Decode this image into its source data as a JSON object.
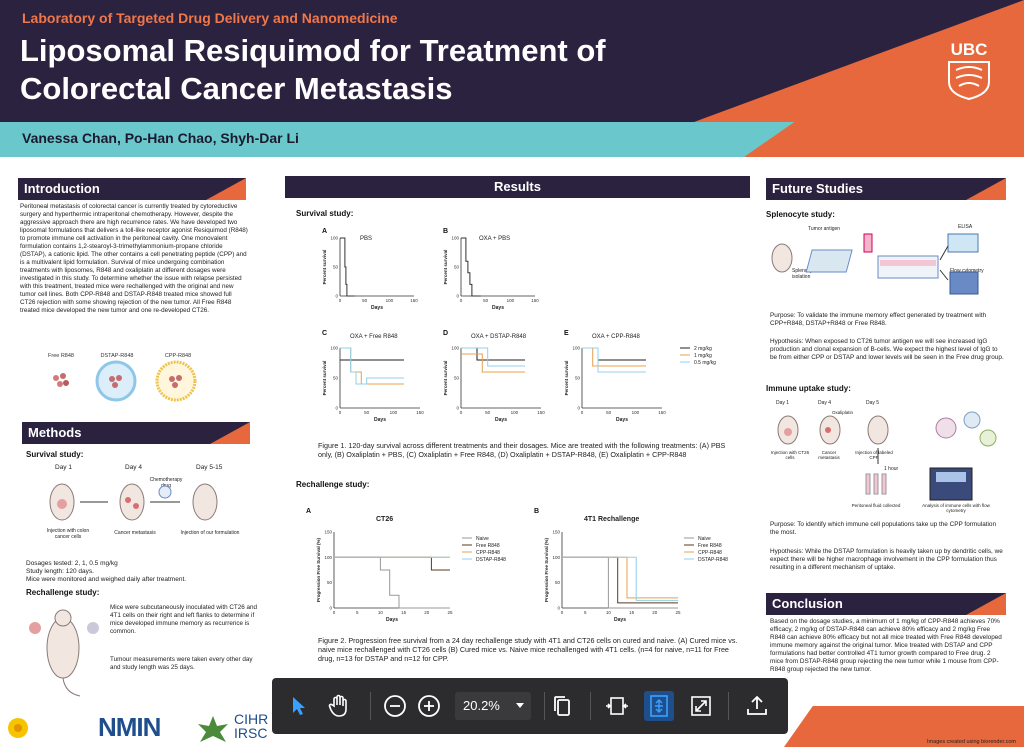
{
  "header": {
    "lab": "Laboratory of Targeted Drug Delivery and Nanomedicine",
    "title": "Liposomal Resiquimod for Treatment of Colorectal Cancer Metastasis",
    "authors": "Vanessa Chan, Po-Han Chao, Shyh-Dar Li",
    "logo": "UBC"
  },
  "intro": {
    "heading": "Introduction",
    "text": "Peritoneal metastasis of colorectal cancer is currently treated by cytoreductive surgery and hyperthermic intraperitonal chemotherapy. However, despite the aggressive approach there are high recurrence rates. We have developed two liposomal formulations that delivers a toll-like receptor agonist Resiquimod (R848) to promote immune cell activation in the peritoneal cavity. One monovalent formulation contains 1,2-stearoyl-3-trimethylammonium-propane chloride (DSTAP), a cationic lipid. The other contains a cell penetrating peptide (CPP) and is a multivalent lipid formulation. Survival of mice undergoing combination treatments with liposomes, R848 and oxaliplatin at different dosages were investigated in this study. To determine whether the issue with relapse persisted with this treatment, treated mice were rechallenged with the original and new tumor cell lines. Both CPP-R848 and DSTAP-R848 treated mice showed full CT26 rejection with some showing rejection of the new tumor. All Free R848 treated mice developed the new tumor and one re-developed CT26.",
    "icons": [
      "Free R848",
      "DSTAP-R848",
      "CPP-R848"
    ]
  },
  "methods": {
    "heading": "Methods",
    "survival_head": "Survival study:",
    "days": [
      "Day 1",
      "Day 4",
      "Day 5-15"
    ],
    "chemo": "Chemotherapy drug",
    "step_labels": [
      "Injection with colon cancer cells",
      "Cancer metastasis",
      "Injection of our formulation"
    ],
    "dosage_text": "Dosages tested: 2, 1, 0.5 mg/kg\nStudy length: 120 days.\nMice were monitored and weighed daily after treatment.",
    "rechallenge_head": "Rechallenge study:",
    "rechallenge_text1": "Mice were subcutaneously inoculated with CT26 and 4T1 cells on their right and left flanks to determine if mice developed immune memory as recurrence is common.",
    "rechallenge_text2": "Tumour measurements were taken every other day and study length was 25 days."
  },
  "results": {
    "heading": "Results",
    "survival_head": "Survival study:",
    "rechallenge_head": "Rechallenge study:",
    "fig1_caption": "Figure 1. 120-day survival across different treatments and their dosages. Mice are treated with the following treatments: (A) PBS only, (B) Oxaliplatin + PBS, (C) Oxaliplatin + Free R848, (D) Oxaliplatin + DSTAP-R848, (E) Oxaliplatin + CPP-R848",
    "fig2_caption": "Figure 2. Progression free survival from a 24 day rechallenge study with 4T1 and CT26 cells on cured and naive. (A) Cured mice vs. naive mice rechallenged with CT26 cells (B) Cured mice vs. Naive mice rechallenged with 4T1 cells. (n=4 for naive, n=11 for Free drug, n=13 for DSTAP and n=12 for CPP."
  },
  "chart_data": [
    {
      "type": "line",
      "panel": "A",
      "title": "PBS",
      "xlabel": "Days",
      "ylabel": "Percent survival",
      "xlim": [
        0,
        150
      ],
      "ylim": [
        0,
        100
      ],
      "x_ticks": [
        "0",
        "50",
        "100",
        "150"
      ],
      "y_ticks": [
        "0",
        "50",
        "100"
      ],
      "series": [
        {
          "x": [
            0,
            10,
            10,
            12,
            12,
            14,
            14,
            30
          ],
          "y": [
            100,
            100,
            50,
            50,
            20,
            20,
            0,
            0
          ]
        }
      ]
    },
    {
      "type": "line",
      "panel": "B",
      "title": "OXA + PBS",
      "xlabel": "Days",
      "ylabel": "Percent survival",
      "xlim": [
        0,
        150
      ],
      "ylim": [
        0,
        100
      ],
      "x_ticks": [
        "0",
        "50",
        "100",
        "150"
      ],
      "y_ticks": [
        "0",
        "50",
        "100"
      ],
      "series": [
        {
          "x": [
            0,
            10,
            10,
            14,
            14,
            18,
            18,
            22,
            22,
            40
          ],
          "y": [
            100,
            100,
            60,
            60,
            40,
            40,
            20,
            20,
            0,
            0
          ]
        }
      ]
    },
    {
      "type": "line",
      "panel": "C",
      "title": "OXA + Free R848",
      "xlabel": "Days",
      "ylabel": "Percent survival",
      "xlim": [
        0,
        150
      ],
      "ylim": [
        0,
        100
      ],
      "x_ticks": [
        "0",
        "50",
        "100",
        "150"
      ],
      "y_ticks": [
        "0",
        "50",
        "100"
      ],
      "series": [
        {
          "name": "2 mg/kg",
          "x": [
            0,
            120
          ],
          "y": [
            80,
            80
          ]
        },
        {
          "name": "1 mg/kg",
          "x": [
            0,
            20,
            20,
            40,
            40,
            120
          ],
          "y": [
            100,
            100,
            60,
            60,
            40,
            40
          ]
        },
        {
          "name": "0.5 mg/kg",
          "x": [
            0,
            20,
            20,
            30,
            30,
            50,
            50,
            120
          ],
          "y": [
            100,
            100,
            60,
            60,
            40,
            40,
            50,
            50
          ]
        }
      ]
    },
    {
      "type": "line",
      "panel": "D",
      "title": "OXA + DSTAP-R848",
      "xlabel": "Days",
      "ylabel": "Percent survival",
      "xlim": [
        0,
        150
      ],
      "ylim": [
        0,
        100
      ],
      "x_ticks": [
        "0",
        "50",
        "100",
        "150"
      ],
      "y_ticks": [
        "0",
        "50",
        "100"
      ],
      "series": [
        {
          "name": "2 mg/kg",
          "x": [
            0,
            30,
            30,
            120
          ],
          "y": [
            100,
            100,
            80,
            80
          ]
        },
        {
          "name": "1 mg/kg",
          "x": [
            0,
            40,
            40,
            120
          ],
          "y": [
            90,
            90,
            60,
            60
          ]
        },
        {
          "name": "0.5 mg/kg",
          "x": [
            0,
            50,
            50,
            120
          ],
          "y": [
            100,
            100,
            70,
            70
          ]
        }
      ]
    },
    {
      "type": "line",
      "panel": "E",
      "title": "OXA + CPP-R848",
      "xlabel": "Days",
      "ylabel": "Percent survival",
      "xlim": [
        0,
        150
      ],
      "ylim": [
        0,
        100
      ],
      "x_ticks": [
        "0",
        "50",
        "100",
        "150"
      ],
      "y_ticks": [
        "0",
        "50",
        "100"
      ],
      "series": [
        {
          "name": "2 mg/kg",
          "x": [
            0,
            30,
            30,
            120
          ],
          "y": [
            100,
            100,
            80,
            80
          ]
        },
        {
          "name": "1 mg/kg",
          "x": [
            0,
            20,
            20,
            120
          ],
          "y": [
            100,
            100,
            70,
            70
          ]
        },
        {
          "name": "0.5 mg/kg",
          "x": [
            0,
            30,
            30,
            120
          ],
          "y": [
            100,
            100,
            60,
            60
          ]
        }
      ]
    },
    {
      "type": "line",
      "panel": "A",
      "title": "CT26",
      "xlabel": "Days",
      "ylabel": "Progression Free Survival (%)",
      "xlim": [
        0,
        25
      ],
      "ylim": [
        0,
        150
      ],
      "x_ticks": [
        "0",
        "5",
        "10",
        "15",
        "20",
        "25"
      ],
      "y_ticks": [
        "0",
        "50",
        "100",
        "150"
      ],
      "series": [
        {
          "name": "Naive",
          "x": [
            0,
            10,
            10,
            12,
            12,
            14,
            14,
            25
          ],
          "y": [
            100,
            100,
            75,
            75,
            25,
            25,
            0,
            0
          ]
        },
        {
          "name": "Free R848",
          "x": [
            0,
            21,
            21,
            25
          ],
          "y": [
            100,
            100,
            75,
            75
          ]
        },
        {
          "name": "CPP-R848",
          "x": [
            0,
            25
          ],
          "y": [
            100,
            100
          ]
        },
        {
          "name": "DSTAP-R848",
          "x": [
            0,
            25
          ],
          "y": [
            100,
            100
          ]
        }
      ]
    },
    {
      "type": "line",
      "panel": "B",
      "title": "4T1 Rechallenge",
      "xlabel": "Days",
      "ylabel": "Progression Free Survival (%)",
      "xlim": [
        0,
        25
      ],
      "ylim": [
        0,
        150
      ],
      "x_ticks": [
        "0",
        "5",
        "10",
        "15",
        "20",
        "25"
      ],
      "y_ticks": [
        "0",
        "50",
        "100",
        "150"
      ],
      "series": [
        {
          "name": "Naive",
          "x": [
            0,
            10,
            10,
            25
          ],
          "y": [
            100,
            100,
            0,
            0
          ]
        },
        {
          "name": "Free R848",
          "x": [
            0,
            12,
            12,
            25
          ],
          "y": [
            100,
            100,
            10,
            10
          ]
        },
        {
          "name": "CPP-R848",
          "x": [
            0,
            14,
            14,
            25
          ],
          "y": [
            100,
            100,
            20,
            20
          ]
        },
        {
          "name": "DSTAP-R848",
          "x": [
            0,
            16,
            16,
            25
          ],
          "y": [
            100,
            100,
            15,
            15
          ]
        }
      ]
    }
  ],
  "future": {
    "heading": "Future Studies",
    "splenocyte_head": "Splenocyte study:",
    "splenocyte_diagram_labels": [
      "Tumor antigen",
      "Splenocyte isolation",
      "ELISA",
      "Flow cytometry"
    ],
    "splenocyte_purpose": "Purpose: To validate the immune memory effect generated by treatment with CPP+R848, DSTAP+R848 or Free R848.",
    "splenocyte_hypothesis": "Hypothesis: When exposed to CT26 tumor antigen we will see increased IgG production and clonal expansion of B-cells. We expect the highest level of IgG to be from either CPP or DSTAP and lower levels will be seen in the Free drug group.",
    "uptake_head": "Immune uptake study:",
    "uptake_diagram_labels": [
      "Day 1",
      "Day 4",
      "Day 5",
      "Oxaliplatin",
      "Injection with CT26 cells",
      "Cancer metastasis",
      "Injection of labeled CPP",
      "1 hour",
      "Peritoneal fluid collected",
      "Analysis of immune cells with flow cytometry"
    ],
    "uptake_purpose": "Purpose: To identify which immune cell populations take up the CPP formulation the most.",
    "uptake_hypothesis": "Hypothesis: While the DSTAP formulation is heavily taken up by dendritic cells, we expect there will be higher macrophage involvement in the CPP formulation thus resulting in a different mechanism of uptake."
  },
  "conclusion": {
    "heading": "Conclusion",
    "text": "Based on the dosage studies, a minimum of 1 mg/kg of CPP-R848 achieves 70% efficacy, 2 mg/kg of DSTAP-R848 can achieve 80% efficacy and 2 mg/kg Free R848 can achieve 80% efficacy but not all mice treated with Free R848 developed immune memory against the original tumor. Mice treated with DSTAP and CPP formulations had better controlled 4T1 tumor growth compared to Free drug. 2 mice from DSTAP-R848 group rejecting the new tumor while 1 mouse from CPP-R848 group rejected the new tumor."
  },
  "toolbar": {
    "zoom": "20.2%"
  },
  "footer": {
    "logos": [
      "NMIN",
      "CIHR",
      "IRSC"
    ],
    "credit": "Images created using biorender.com"
  },
  "colors": {
    "navy": "#2b2240",
    "orange": "#e7683c",
    "teal": "#6ac7cc",
    "naive": "#999999",
    "free": "#5a3a1a",
    "cpp": "#e8a04a",
    "dstap": "#8fd0e8"
  }
}
